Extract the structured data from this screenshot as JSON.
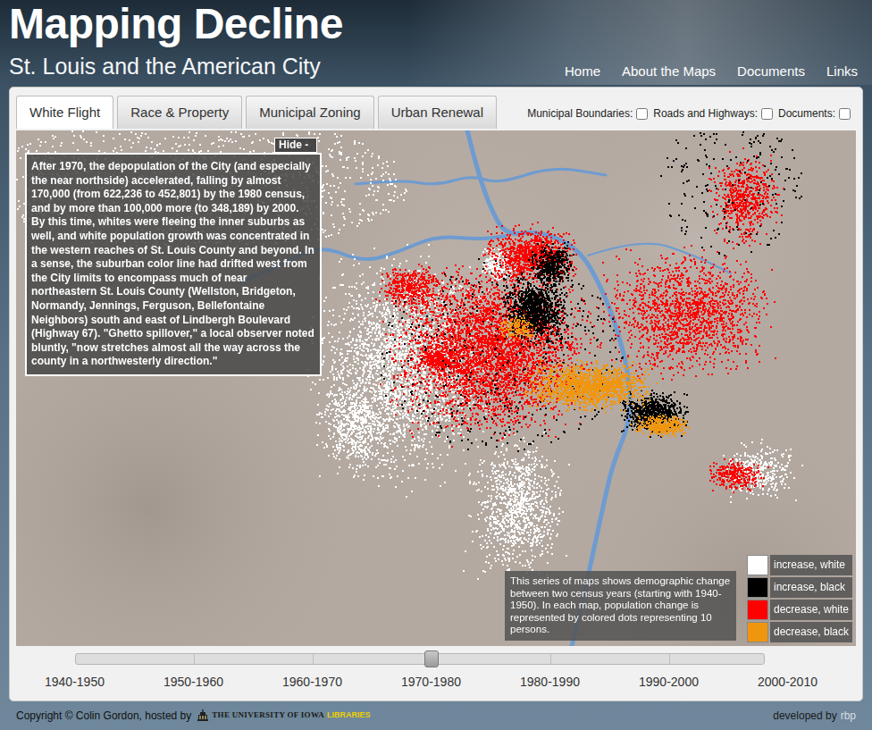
{
  "header": {
    "title": "Mapping Decline",
    "subtitle": "St. Louis and the American City",
    "nav": [
      {
        "label": "Home"
      },
      {
        "label": "About the Maps"
      },
      {
        "label": "Documents"
      },
      {
        "label": "Links"
      }
    ]
  },
  "tabs": [
    {
      "label": "White Flight",
      "selected": true
    },
    {
      "label": "Race & Property",
      "selected": false
    },
    {
      "label": "Municipal Zoning",
      "selected": false
    },
    {
      "label": "Urban Renewal",
      "selected": false
    }
  ],
  "layers": [
    {
      "label": "Municipal Boundaries:",
      "checked": false
    },
    {
      "label": "Roads and Highways:",
      "checked": false
    },
    {
      "label": "Documents:",
      "checked": false
    }
  ],
  "map": {
    "hide_button": "Hide -",
    "narrative": "After 1970, the depopulation of the City (and especially the near northside) accelerated, falling by almost 170,000 (from 622,236 to 452,801) by the 1980 census, and by more than 100,000 more (to 348,189) by 2000. By this time, whites were fleeing the inner suburbs as well, and white population growth was concentrated in the western reaches of St. Louis County and beyond. In a sense, the suburban color line had drifted west from the City limits to encompass much of near northeastern St. Louis County (Wellston, Bridgeton, Normandy, Jennings, Ferguson, Bellefontaine Neighbors) south and east of Lindbergh Boulevard (Highway 67). \"Ghetto spillover,\" a local observer noted bluntly, \"now stretches almost all the way across the county in a northwesterly direction.\"",
    "description": "This series of maps shows demographic change between two census years (starting with 1940-1950). In each map, population change is represented by colored dots representing 10 persons.",
    "legend": [
      {
        "label": "increase, white",
        "color": "#ffffff"
      },
      {
        "label": "increase, black",
        "color": "#000000"
      },
      {
        "label": "decrease, white",
        "color": "#ff0000"
      },
      {
        "label": "decrease, black",
        "color": "#f0960e"
      }
    ]
  },
  "timeline": {
    "level": 0.5,
    "periods": [
      {
        "label": "1940-1950"
      },
      {
        "label": "1950-1960"
      },
      {
        "label": "1960-1970"
      },
      {
        "label": "1970-1980"
      },
      {
        "label": "1980-1990"
      },
      {
        "label": "1990-2000"
      },
      {
        "label": "2000-2010"
      }
    ]
  },
  "footer": {
    "copyright": "Copyright © Colin Gordon, hosted by",
    "library": "THE UNIVERSITY OF IOWA",
    "library_suffix": "LIBRARIES",
    "developed_by": "developed by",
    "developer": "rbp"
  }
}
